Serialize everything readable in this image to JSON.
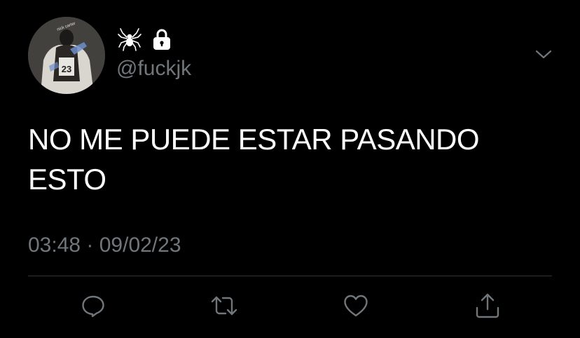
{
  "user": {
    "handle": "@fuckjk",
    "name_icons": [
      "spider-icon",
      "lock-icon"
    ],
    "avatar": "profile-photo"
  },
  "tweet": {
    "text": "NO ME PUEDE ESTAR PASANDO\nESTO",
    "timestamp": "03:48 · 09/02/23"
  },
  "menu": {
    "icon": "chevron-down-icon"
  },
  "actions": [
    {
      "name": "reply",
      "icon": "speech-bubble-icon"
    },
    {
      "name": "retweet",
      "icon": "retweet-icon"
    },
    {
      "name": "like",
      "icon": "heart-icon"
    },
    {
      "name": "share",
      "icon": "share-icon"
    }
  ],
  "colors": {
    "background": "#000000",
    "text": "#ffffff",
    "secondary": "#71767b",
    "divider": "#2f3336"
  }
}
